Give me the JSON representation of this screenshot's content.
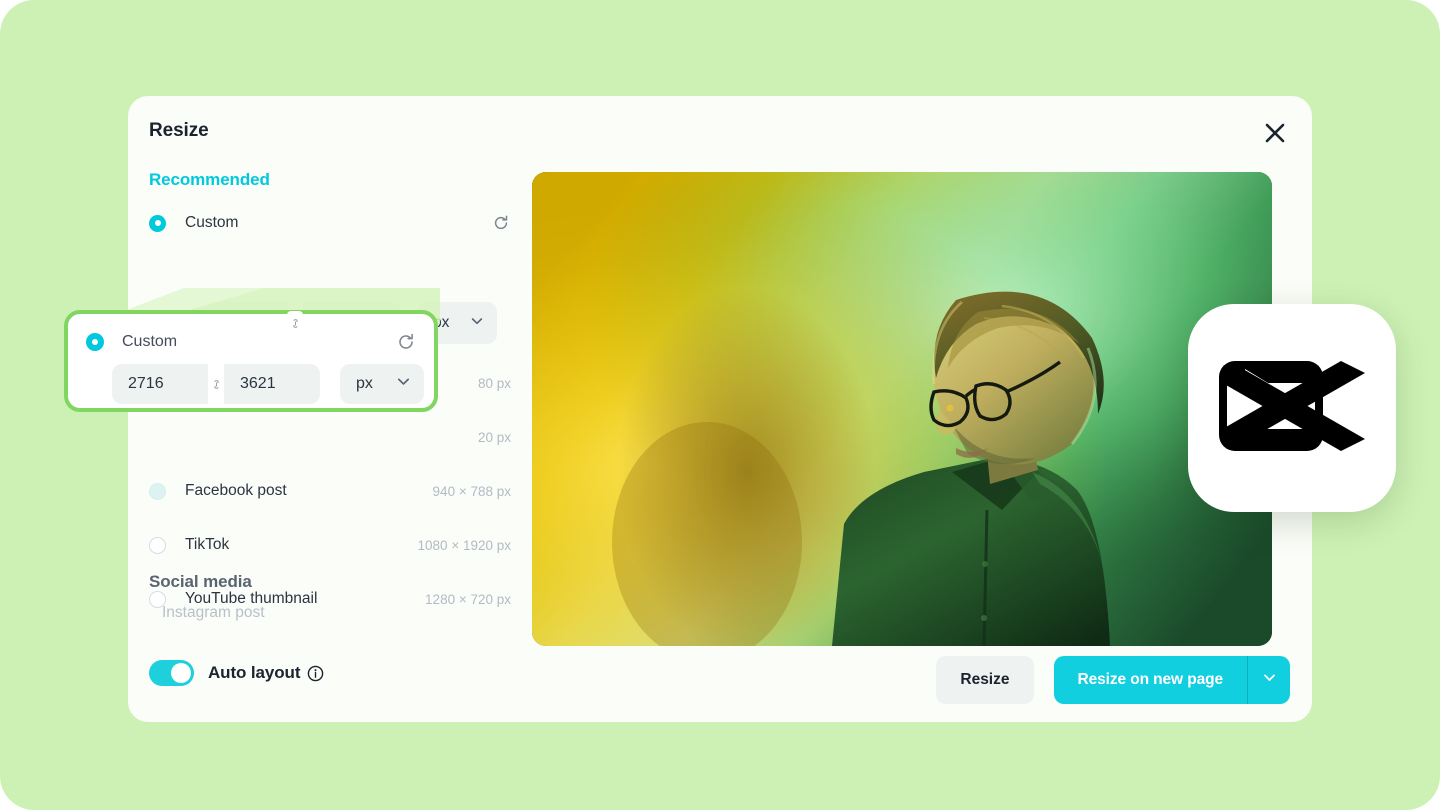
{
  "theme": {
    "page_background": "#cdf1b4",
    "dialog_background": "#fbfdf8",
    "accent_cyan": "#00c9dd",
    "primary_button": "#12cfdf",
    "highlight_green": "#81d662",
    "muted_text": "#b2bac4"
  },
  "dialog": {
    "title": "Resize",
    "close_label": "Close"
  },
  "panel": {
    "recommended_heading": "Recommended",
    "social_heading": "Social media",
    "options": [
      {
        "label": "Custom",
        "dimensions": "",
        "selected": true,
        "has_reset": true
      },
      {
        "label": "",
        "dimensions": "80 px",
        "selected": false,
        "occluded": true
      },
      {
        "label": "",
        "dimensions": "20 px",
        "selected": false,
        "occluded": true
      },
      {
        "label": "Facebook post",
        "dimensions": "940 × 788 px",
        "selected": false,
        "hovered": true
      },
      {
        "label": "TikTok",
        "dimensions": "1080 × 1920 px",
        "selected": false
      },
      {
        "label": "YouTube thumbnail",
        "dimensions": "1280 × 720 px",
        "selected": false
      }
    ],
    "social_items": [
      {
        "label": "Instagram post"
      }
    ],
    "custom_size": {
      "width": "2716",
      "height": "3621",
      "unit": "px",
      "link_locked": true
    }
  },
  "magnifier": {
    "label": "Custom",
    "width": "2716",
    "height": "3621",
    "unit": "px"
  },
  "footer": {
    "auto_layout_label": "Auto layout",
    "auto_layout_on": true,
    "resize_label": "Resize",
    "resize_new_page_label": "Resize on new page"
  },
  "preview": {
    "alt": "Portrait of a person in a dark green shirt with glasses lit by yellow and green gradient lighting"
  },
  "logo": {
    "name": "capcut-logo"
  }
}
